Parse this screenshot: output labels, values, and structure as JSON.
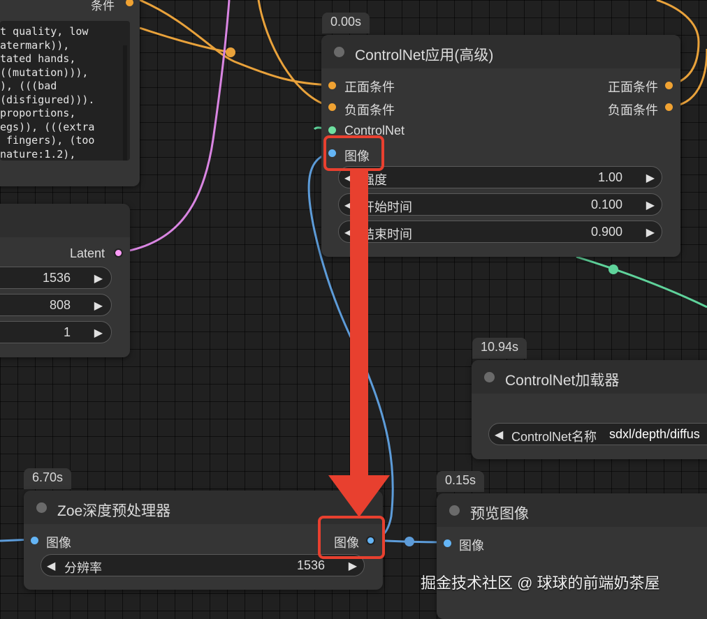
{
  "prompt_node": {
    "top_label": "条件",
    "lines": [
      "t quality, low",
      "atermark)),",
      "tated hands,",
      "((mutation))),",
      "), (((bad",
      "(disfigured))).",
      "proportions,",
      "egs)), (((extra",
      " fingers), (too",
      "nature:1.2),"
    ]
  },
  "latent_node": {
    "output_label": "Latent",
    "width_value": "1536",
    "height_value": "808",
    "batch_value": "1"
  },
  "controlnet_apply": {
    "time": "0.00s",
    "title": "ControlNet应用(高级)",
    "inputs": [
      "正面条件",
      "负面条件",
      "ControlNet",
      "图像"
    ],
    "outputs": [
      "正面条件",
      "负面条件"
    ],
    "strength_label": "强度",
    "strength_value": "1.00",
    "start_label": "开始时间",
    "start_value": "0.100",
    "end_label": "结束时间",
    "end_value": "0.900"
  },
  "controlnet_loader": {
    "time": "10.94s",
    "title": "ControlNet加载器",
    "name_label": "ControlNet名称",
    "name_value": "sdxl/depth/diffus"
  },
  "zoe_node": {
    "time": "6.70s",
    "title": "Zoe深度预处理器",
    "input_label": "图像",
    "output_label": "图像",
    "resolution_label": "分辨率",
    "resolution_value": "1536"
  },
  "preview_node": {
    "time": "0.15s",
    "title": "预览图像",
    "input_label": "图像"
  },
  "watermark": "掘金技术社区 @ 球球的前端奶茶屋",
  "colors": {
    "conditioning": "#f0a232",
    "controlnet": "#6ee0a0",
    "image": "#64b5f6",
    "latent": "#ff9cf9",
    "highlight": "#e8402f"
  },
  "icons": {
    "left_arrow": "◀",
    "right_arrow": "▶"
  }
}
